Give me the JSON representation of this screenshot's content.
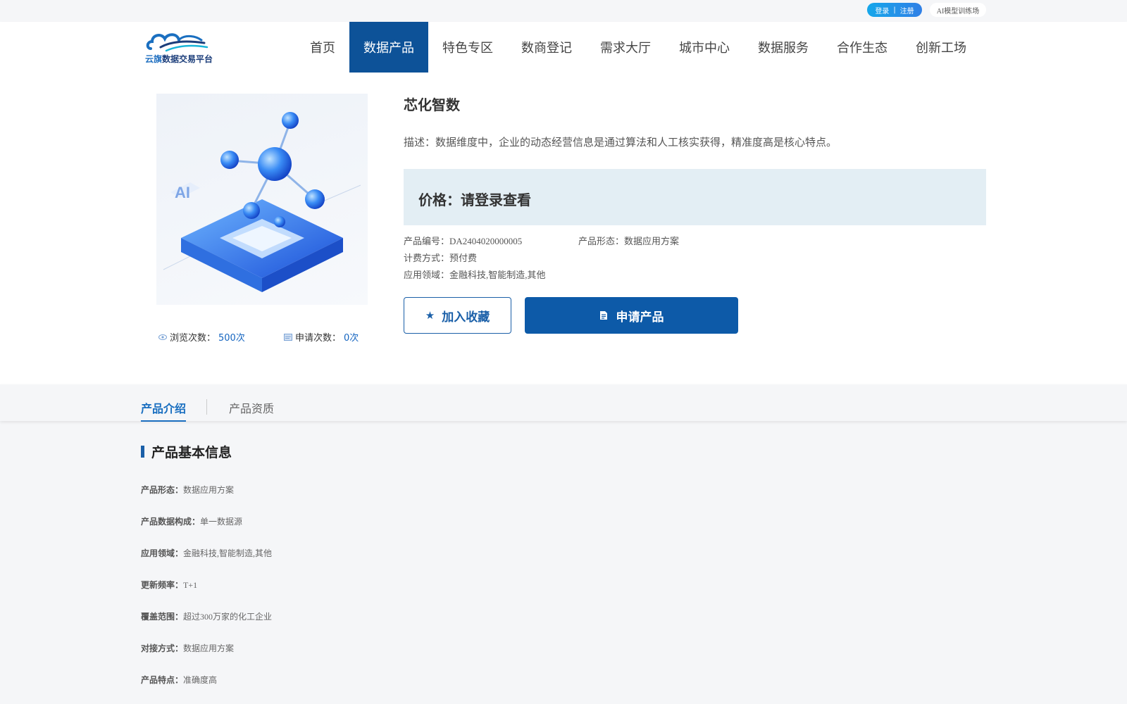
{
  "topbar": {
    "login": "登录",
    "divider": "|",
    "register": "注册",
    "ai_training": "AI模型训练场"
  },
  "header": {
    "logo_text_a": "云旗",
    "logo_text_b": "数据交易平台",
    "nav": [
      {
        "label": "首页",
        "active": false
      },
      {
        "label": "数据产品",
        "active": true
      },
      {
        "label": "特色专区",
        "active": false
      },
      {
        "label": "数商登记",
        "active": false
      },
      {
        "label": "需求大厅",
        "active": false
      },
      {
        "label": "城市中心",
        "active": false
      },
      {
        "label": "数据服务",
        "active": false
      },
      {
        "label": "合作生态",
        "active": false
      },
      {
        "label": "创新工场",
        "active": false
      }
    ]
  },
  "product": {
    "title": "芯化智数",
    "description": "描述：数据维度中，企业的动态经营信息是通过算法和人工核实获得，精准度高是核心特点。",
    "price": "价格：请登录查看",
    "image_label": "AI",
    "stats": {
      "views_label": "浏览次数：",
      "views_value": "500次",
      "applies_label": "申请次数：",
      "applies_value": "0次"
    },
    "meta": {
      "code": "产品编号：DA2404020000005",
      "form": "产品形态：数据应用方案",
      "billing": "计费方式：预付费",
      "domain": "应用领域：金融科技,智能制造,其他"
    },
    "buttons": {
      "favorite": "加入收藏",
      "apply": "申请产品"
    }
  },
  "tabs": {
    "intro": "产品介绍",
    "qualification": "产品资质"
  },
  "basic_info": {
    "title": "产品基本信息",
    "rows": [
      {
        "key": "产品形态：",
        "value": "数据应用方案"
      },
      {
        "key": "产品数据构成：",
        "value": "单一数据源"
      },
      {
        "key": "应用领域：",
        "value": "金融科技,智能制造,其他"
      },
      {
        "key": "更新频率：",
        "value": "T+1"
      },
      {
        "key": "覆盖范围：",
        "value": "超过300万家的化工企业"
      },
      {
        "key": "对接方式：",
        "value": "数据应用方案"
      },
      {
        "key": "产品特点：",
        "value": "准确度高"
      }
    ]
  },
  "colors": {
    "primary": "#0d5298",
    "accent": "#1a6fc0",
    "price_bg": "#e3eef4"
  }
}
